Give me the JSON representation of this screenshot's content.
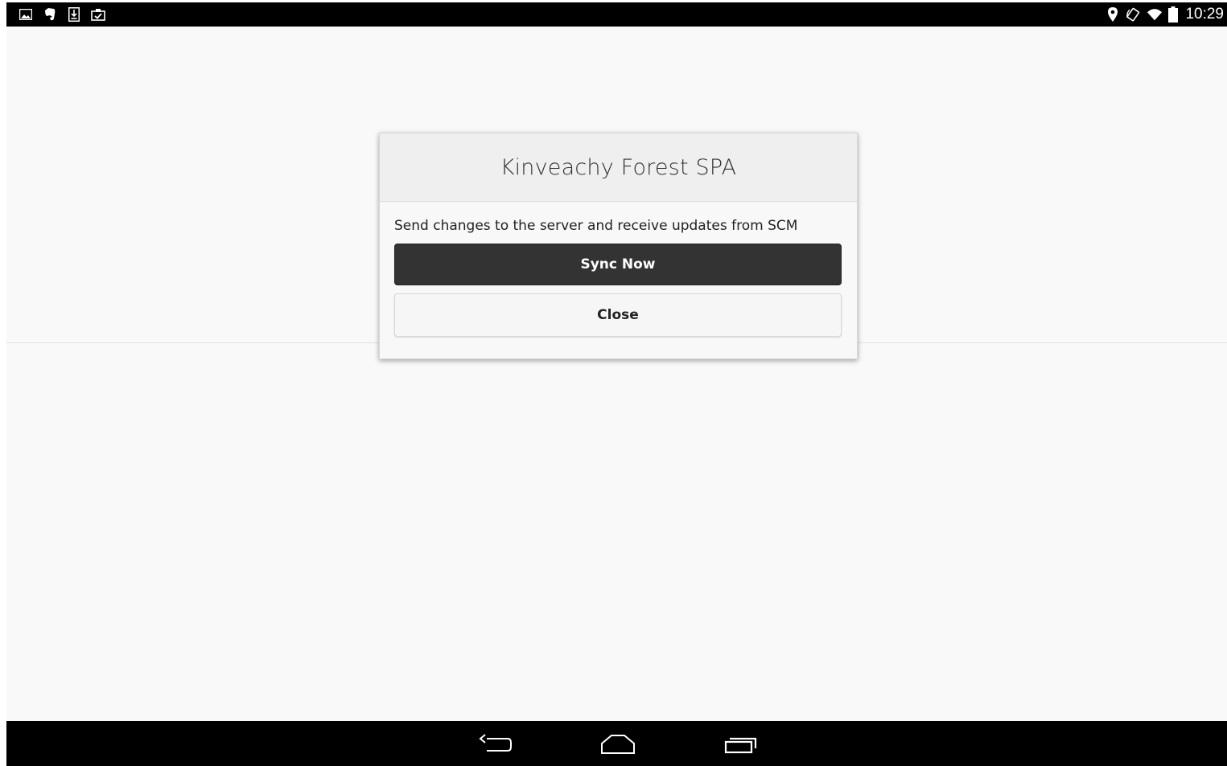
{
  "status_bar": {
    "left_icons": [
      "gallery-icon",
      "evernote-icon",
      "download-icon",
      "clipboard-check-icon"
    ],
    "right_icons": [
      "location-icon",
      "rotate-icon",
      "wifi-icon",
      "battery-icon"
    ],
    "time": "10:29"
  },
  "dialog": {
    "title": "Kinveachy Forest SPA",
    "message": "Send changes to the server and receive updates from SCM",
    "primary_button": "Sync Now",
    "secondary_button": "Close"
  },
  "nav_bar": {
    "buttons": [
      "back-icon",
      "home-icon",
      "recents-icon"
    ]
  },
  "colors": {
    "status_bar_bg": "#000000",
    "page_bg": "#f9f9f9",
    "primary_button_bg": "#333333",
    "secondary_button_bg": "#f6f6f6"
  }
}
